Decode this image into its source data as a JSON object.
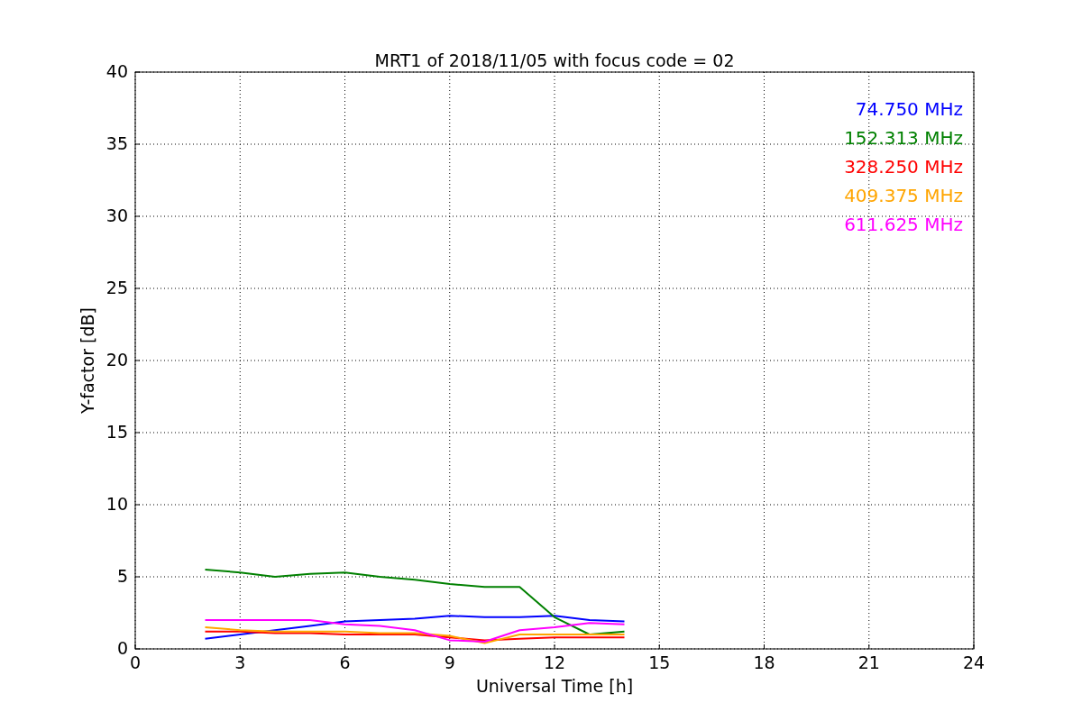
{
  "chart_data": {
    "type": "line",
    "title": "MRT1 of 2018/11/05 with focus code = 02",
    "xlabel": "Universal Time [h]",
    "ylabel": "Y-factor [dB]",
    "x": [
      2,
      3,
      4,
      5,
      6,
      7,
      8,
      9,
      10,
      11,
      12,
      13,
      14
    ],
    "series": [
      {
        "name": "74.750 MHz",
        "color": "#0000ff",
        "values": [
          0.7,
          1.0,
          1.3,
          1.6,
          1.9,
          2.0,
          2.1,
          2.3,
          2.2,
          2.2,
          2.3,
          2.0,
          1.9
        ]
      },
      {
        "name": "152.313 MHz",
        "color": "#008000",
        "values": [
          5.5,
          5.3,
          5.0,
          5.2,
          5.3,
          5.0,
          4.8,
          4.5,
          4.3,
          4.3,
          2.2,
          1.0,
          1.2
        ]
      },
      {
        "name": "328.250 MHz",
        "color": "#ff0000",
        "values": [
          1.2,
          1.2,
          1.1,
          1.1,
          1.0,
          1.0,
          1.0,
          0.8,
          0.6,
          0.7,
          0.8,
          0.8,
          0.8
        ]
      },
      {
        "name": "409.375 MHz",
        "color": "#ffa500",
        "values": [
          1.5,
          1.3,
          1.2,
          1.2,
          1.2,
          1.1,
          1.1,
          0.9,
          0.4,
          1.0,
          1.0,
          1.0,
          1.0
        ]
      },
      {
        "name": "611.625 MHz",
        "color": "#ff00ff",
        "values": [
          2.0,
          2.0,
          2.0,
          2.0,
          1.7,
          1.6,
          1.3,
          0.6,
          0.5,
          1.3,
          1.5,
          1.8,
          1.7
        ]
      }
    ],
    "grid": true,
    "xlim": [
      0,
      24
    ],
    "ylim": [
      0,
      40
    ],
    "xticks": [
      0,
      3,
      6,
      9,
      12,
      15,
      18,
      21,
      24
    ],
    "yticks": [
      0,
      5,
      10,
      15,
      20,
      25,
      30,
      35,
      40
    ]
  }
}
